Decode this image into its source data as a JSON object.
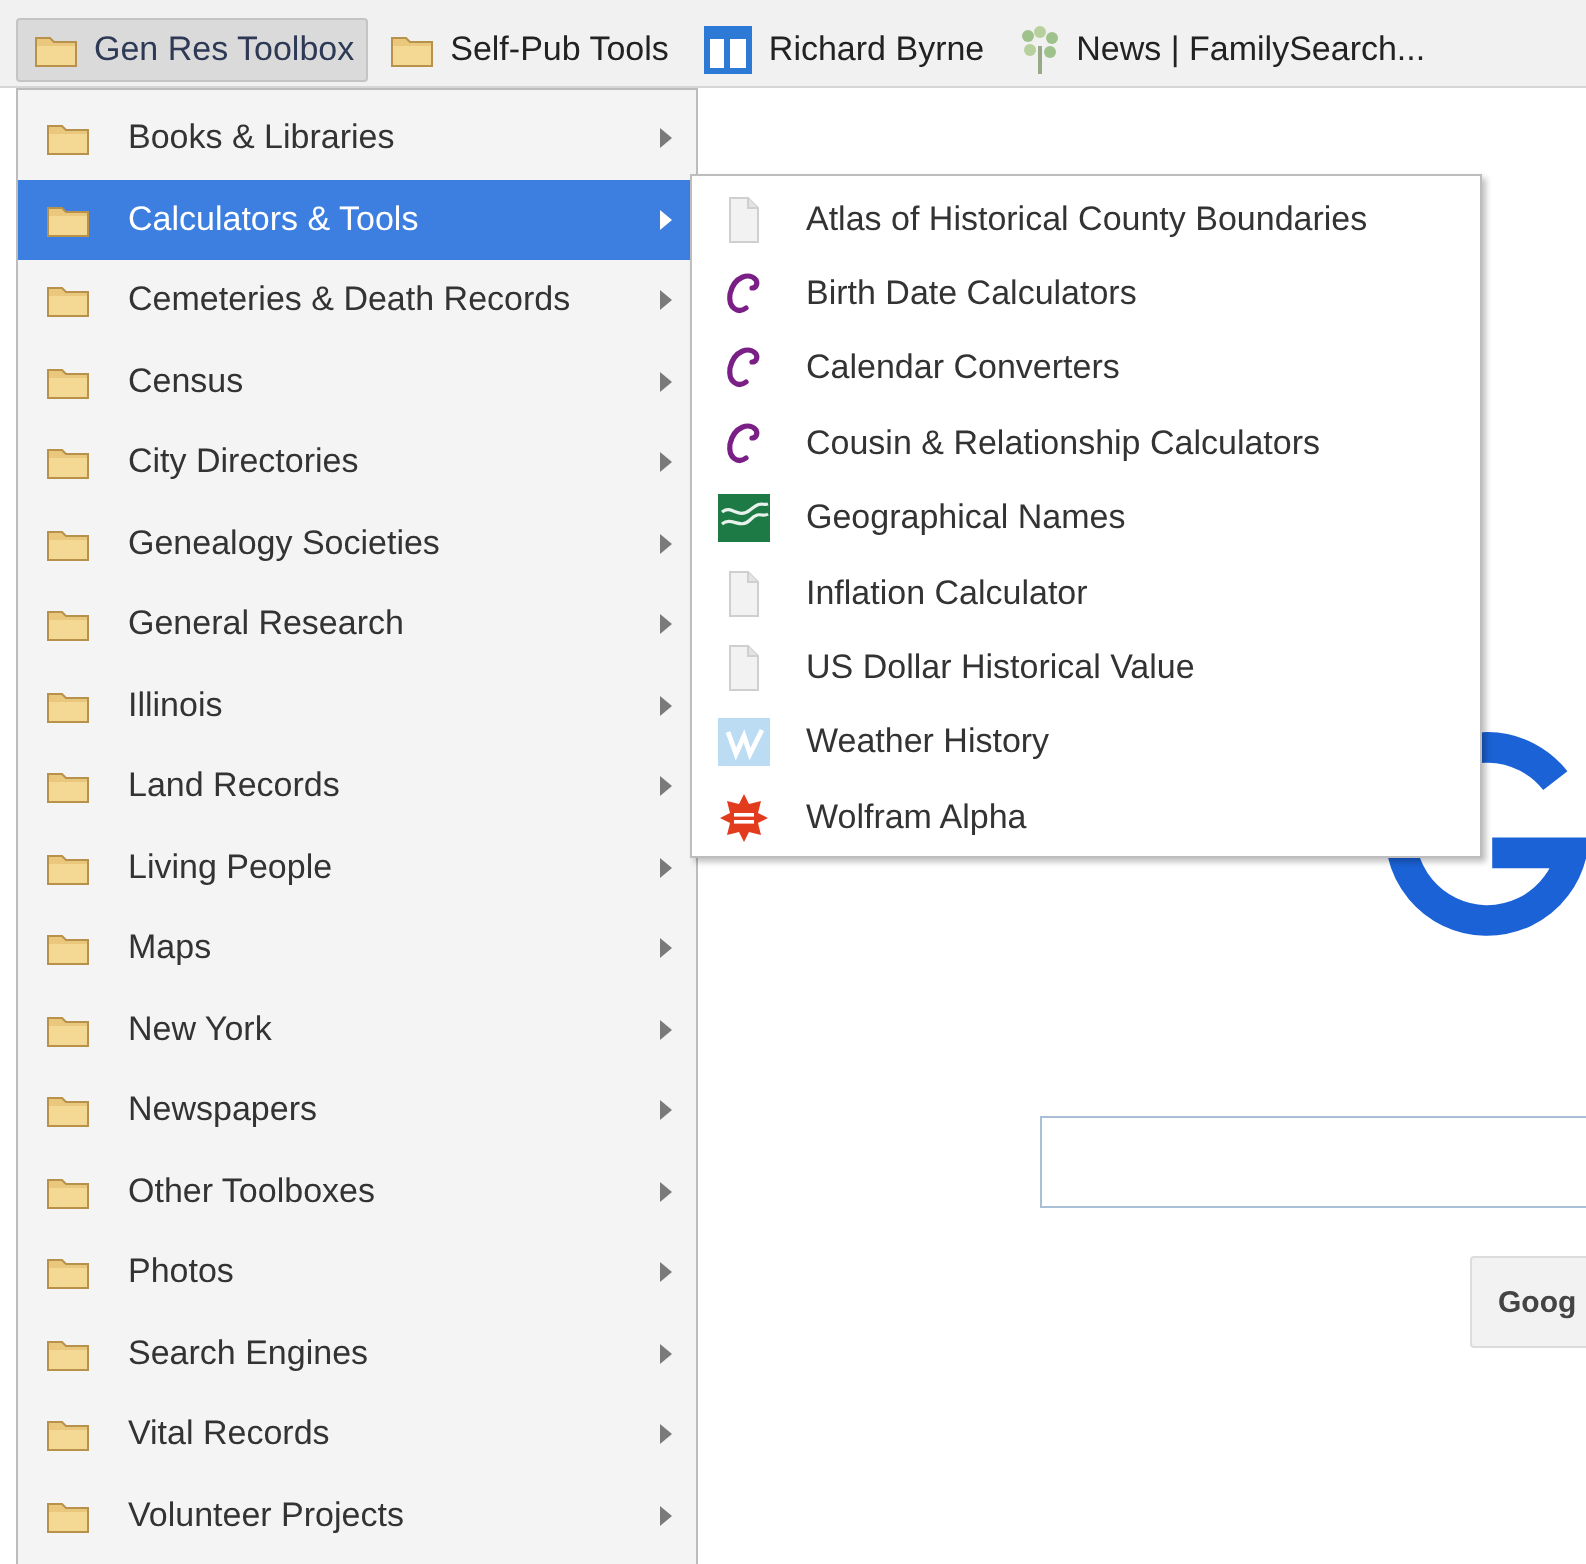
{
  "bookmarks_bar": {
    "items": [
      {
        "label": "Gen Res Toolbox",
        "kind": "folder",
        "selected": true
      },
      {
        "label": "Self-Pub Tools",
        "kind": "folder",
        "selected": false
      },
      {
        "label": "Richard Byrne",
        "kind": "layout",
        "selected": false
      },
      {
        "label": "News | FamilySearch...",
        "kind": "tree",
        "selected": false
      }
    ]
  },
  "folder_menu": {
    "items": [
      {
        "label": "Books & Libraries",
        "selected": false
      },
      {
        "label": "Calculators & Tools",
        "selected": true
      },
      {
        "label": "Cemeteries & Death Records",
        "selected": false
      },
      {
        "label": "Census",
        "selected": false
      },
      {
        "label": "City Directories",
        "selected": false
      },
      {
        "label": "Genealogy Societies",
        "selected": false
      },
      {
        "label": "General Research",
        "selected": false
      },
      {
        "label": "Illinois",
        "selected": false
      },
      {
        "label": "Land Records",
        "selected": false
      },
      {
        "label": "Living People",
        "selected": false
      },
      {
        "label": "Maps",
        "selected": false
      },
      {
        "label": "New York",
        "selected": false
      },
      {
        "label": "Newspapers",
        "selected": false
      },
      {
        "label": "Other Toolboxes",
        "selected": false
      },
      {
        "label": "Photos",
        "selected": false
      },
      {
        "label": "Search Engines",
        "selected": false
      },
      {
        "label": "Vital Records",
        "selected": false
      },
      {
        "label": "Volunteer Projects",
        "selected": false
      }
    ]
  },
  "submenu": {
    "items": [
      {
        "label": "Atlas of Historical County Boundaries",
        "kind": "page"
      },
      {
        "label": "Birth Date Calculators",
        "kind": "curl"
      },
      {
        "label": "Calendar Converters",
        "kind": "curl"
      },
      {
        "label": "Cousin & Relationship Calculators",
        "kind": "curl"
      },
      {
        "label": "Geographical Names",
        "kind": "map"
      },
      {
        "label": "Inflation Calculator",
        "kind": "page"
      },
      {
        "label": "US Dollar Historical Value",
        "kind": "page"
      },
      {
        "label": "Weather History",
        "kind": "weather"
      },
      {
        "label": "Wolfram Alpha",
        "kind": "burst"
      }
    ]
  },
  "page": {
    "button": "Goog"
  }
}
